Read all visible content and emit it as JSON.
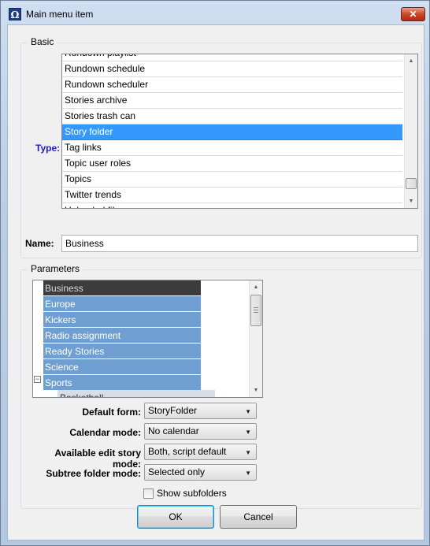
{
  "window": {
    "title": "Main menu item",
    "close_glyph": "✕",
    "app_icon_glyph": "Ω"
  },
  "basic": {
    "legend": "Basic",
    "type_label": "Type:",
    "type_items": [
      "Rundown playlist",
      "Rundown schedule",
      "Rundown scheduler",
      "Stories archive",
      "Stories trash can",
      "Story folder",
      "Tag links",
      "Topic user roles",
      "Topics",
      "Twitter trends",
      "Unloaded files"
    ],
    "selected_type": "Story folder",
    "name_label": "Name:",
    "name_value": "Business"
  },
  "parameters": {
    "legend": "Parameters",
    "folders": [
      "Business",
      "Europe",
      "Kickers",
      "Radio assignment",
      "Ready Stories",
      "Science",
      "Sports"
    ],
    "selected_folder": "Business",
    "child_partial": "Basketball",
    "expander_glyph": "−",
    "default_form_label": "Default form:",
    "default_form_value": "StoryFolder",
    "calendar_mode_label": "Calendar mode:",
    "calendar_mode_value": "No calendar",
    "edit_story_mode_label": "Available edit story mode:",
    "edit_story_mode_value": "Both, script default",
    "subtree_mode_label": "Subtree folder mode:",
    "subtree_mode_value": "Selected only",
    "show_subfolders_label": "Show subfolders",
    "show_subfolders_checked": false
  },
  "buttons": {
    "ok": "OK",
    "cancel": "Cancel"
  },
  "icons": {
    "combo_arrow": "▼",
    "scroll_up": "▲",
    "scroll_down": "▼"
  },
  "colors": {
    "selection": "#3399ff",
    "folder_item": "#6f9fd0",
    "selected_folder": "#3c3c3c",
    "type_label": "#2020c0",
    "close_button": "#c9472b"
  }
}
